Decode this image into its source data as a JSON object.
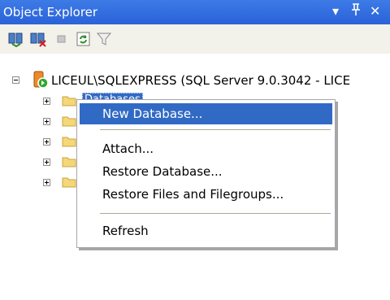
{
  "window": {
    "title": "Object Explorer",
    "controls": [
      "▾",
      "ᚹ",
      "✕"
    ]
  },
  "toolbar": {
    "buttons": [
      "connect-icon",
      "disconnect-icon",
      "stop-icon",
      "refresh-icon",
      "filter-icon"
    ]
  },
  "tree": {
    "server": "LICEUL\\SQLEXPRESS (SQL Server 9.0.3042 - LICE",
    "selected_node": "Databases",
    "child_nodes": 5
  },
  "context_menu": {
    "items": [
      {
        "label": "New Database...",
        "selected": true
      },
      {
        "label": "Attach...",
        "selected": false
      },
      {
        "label": "Restore Database...",
        "selected": false
      },
      {
        "label": "Restore Files and Filegroups...",
        "selected": false
      },
      {
        "label": "Refresh",
        "selected": false
      }
    ]
  },
  "colors": {
    "titlebar": "#3d7be7",
    "selection": "#316ac5",
    "folder": "#f5d77a"
  }
}
